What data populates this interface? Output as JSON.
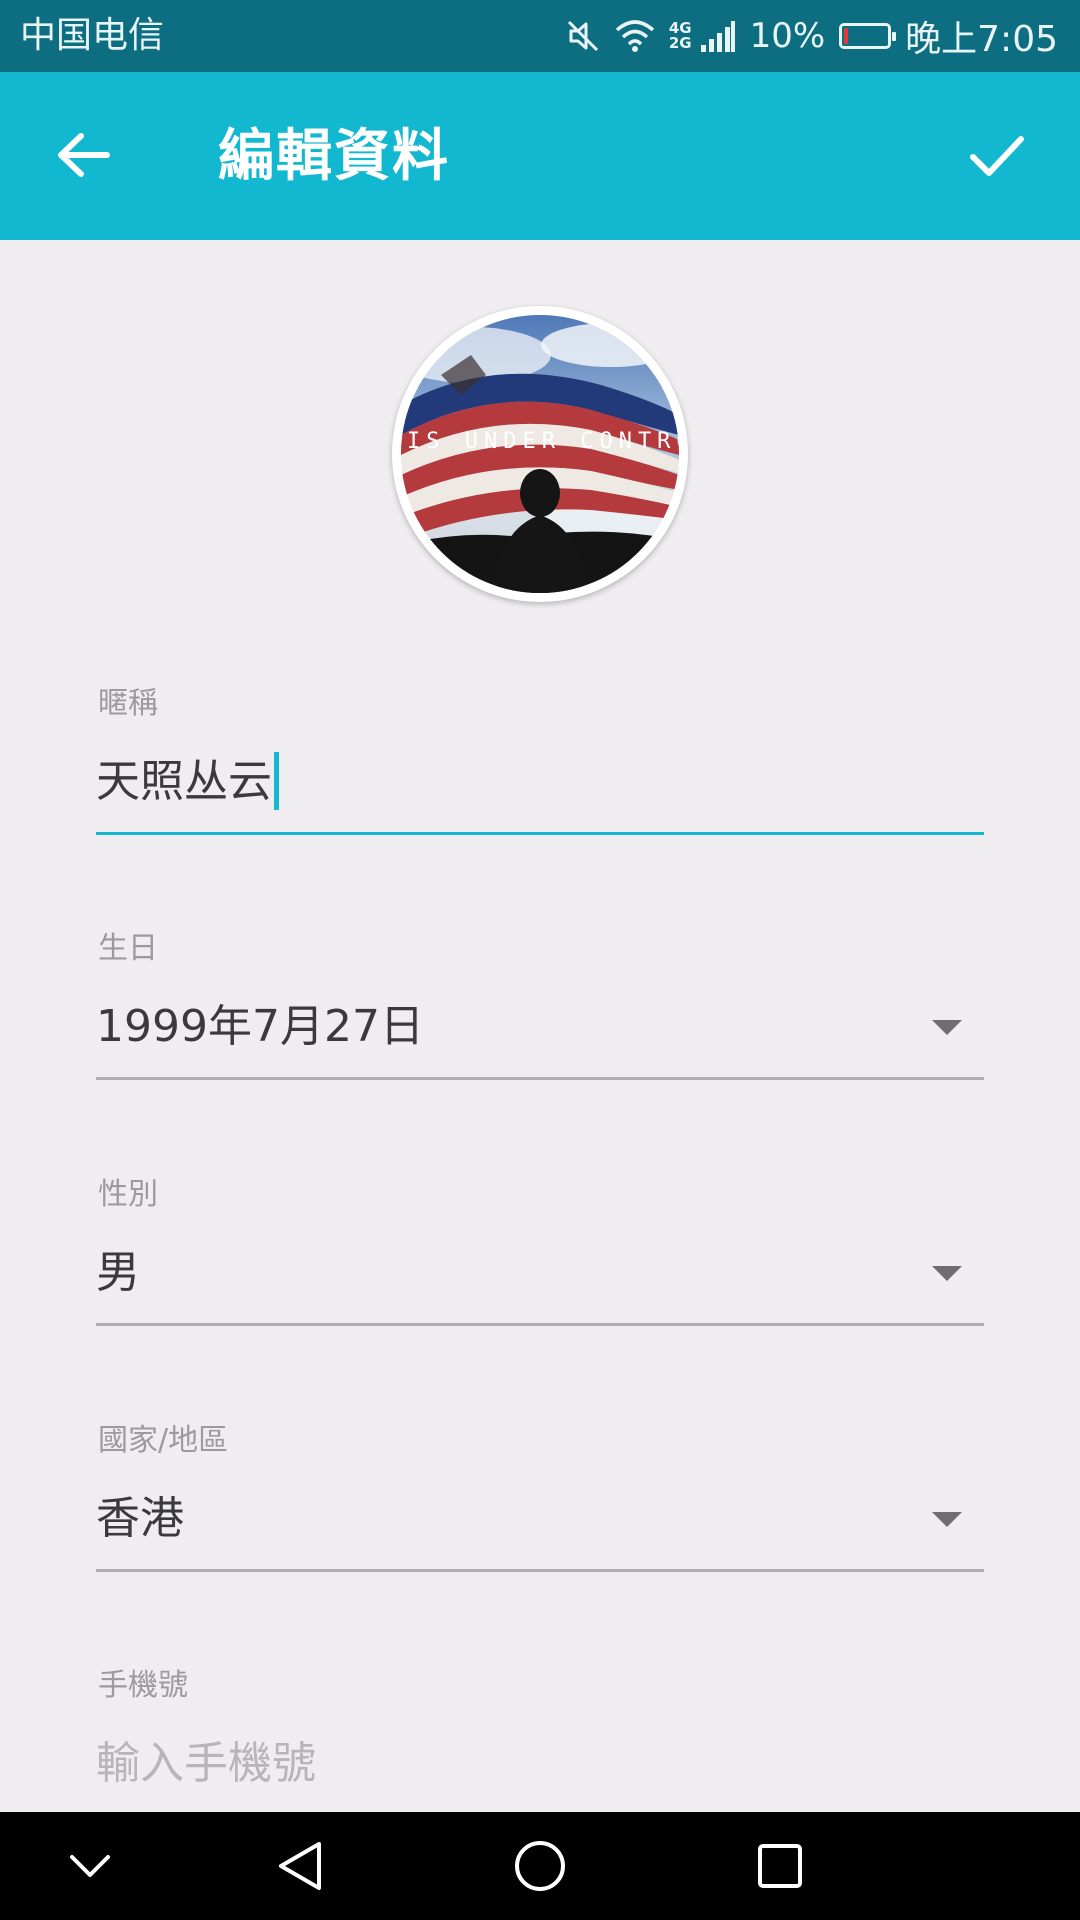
{
  "status_bar": {
    "carrier": "中国电信",
    "network_top": "4G",
    "network_bottom": "2G",
    "battery_percent": "10%",
    "battery_level": 0.1,
    "time": "晚上7:05"
  },
  "app_bar": {
    "title": "編輯資料",
    "back_icon": "arrow-left-icon",
    "done_icon": "check-icon"
  },
  "avatar": {
    "overlay_text": "IS UNDER CONTROL"
  },
  "form": {
    "nickname": {
      "label": "暱稱",
      "value": "天照丛云"
    },
    "birthday": {
      "label": "生日",
      "value": "1999年7月27日"
    },
    "gender": {
      "label": "性別",
      "value": "男"
    },
    "region": {
      "label": "國家/地區",
      "value": "香港"
    },
    "phone": {
      "label": "手機號",
      "placeholder": "輸入手機號"
    }
  },
  "nav_bar": {
    "icons": [
      "chevron-down-icon",
      "back-triangle-icon",
      "home-circle-icon",
      "recents-square-icon"
    ]
  },
  "colors": {
    "status_bar_bg": "#0c6e80",
    "app_bar_bg": "#12b8d0",
    "page_bg": "#efedf0",
    "accent": "#12b8d0"
  }
}
